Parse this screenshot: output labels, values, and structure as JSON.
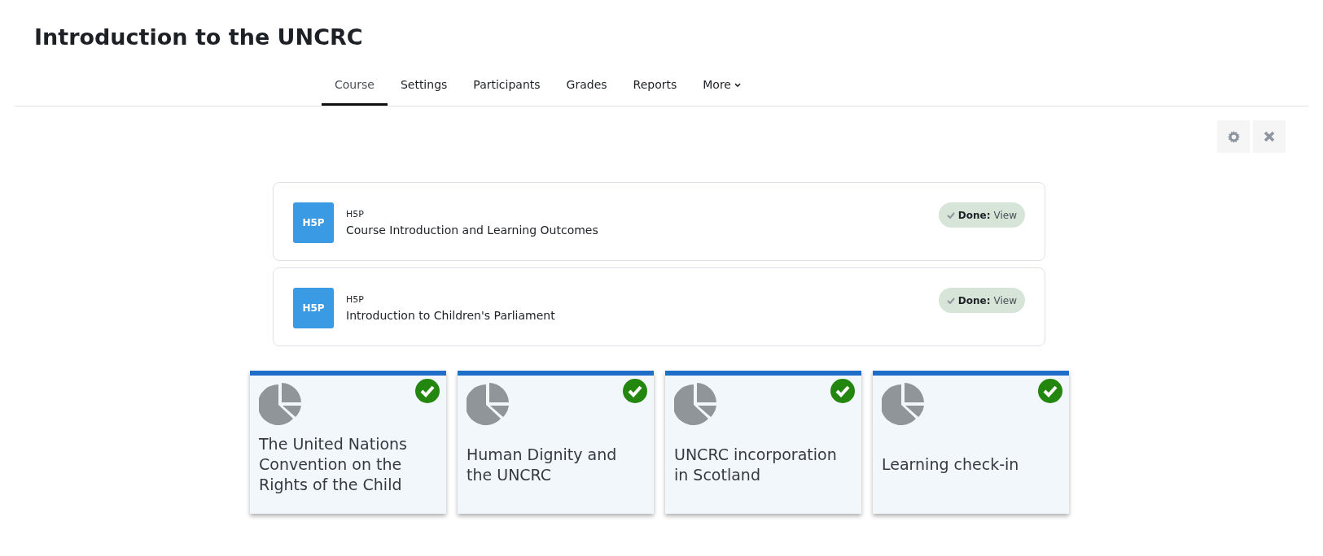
{
  "page_title": "Introduction to the UNCRC",
  "tabs": [
    {
      "label": "Course",
      "selected": true
    },
    {
      "label": "Settings",
      "selected": false
    },
    {
      "label": "Participants",
      "selected": false
    },
    {
      "label": "Grades",
      "selected": false
    },
    {
      "label": "Reports",
      "selected": false
    },
    {
      "label": "More",
      "selected": false,
      "dropdown": true
    }
  ],
  "activities": [
    {
      "logo": "H5P",
      "type": "H5P",
      "name": "Course Introduction and Learning Outcomes",
      "completion_label": "Done:",
      "completion_action": "View",
      "done": true
    },
    {
      "logo": "H5P",
      "type": "H5P",
      "name": "Introduction to Children's Parliament",
      "completion_label": "Done:",
      "completion_action": "View",
      "done": true
    }
  ],
  "tiles": [
    {
      "title": "The United Nations Convention on the Rights of the Child",
      "complete": true
    },
    {
      "title": "Human Dignity and the UNCRC",
      "complete": true
    },
    {
      "title": "UNCRC incorporation in Scotland",
      "complete": true
    },
    {
      "title": "Learning check-in",
      "complete": true
    }
  ]
}
